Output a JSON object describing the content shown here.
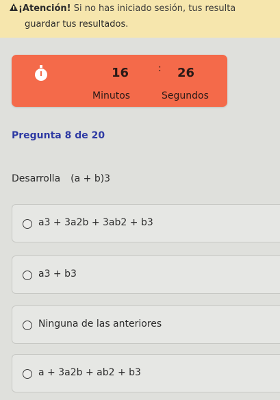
{
  "alert": {
    "title": "¡Atención!",
    "message": "Si no has iniciado sesión, tus resulta",
    "line2": "guardar tus resultados."
  },
  "timer": {
    "minutes": "16",
    "separator": ":",
    "seconds": "26",
    "minutes_label": "Minutos",
    "seconds_label": "Segundos",
    "color": "#f46a4a"
  },
  "question": {
    "counter": "Pregunta 8 de 20",
    "prompt": "Desarrolla",
    "expression": "(a + b)3"
  },
  "options": [
    {
      "label": "a3 + 3a2b + 3ab2 + b3"
    },
    {
      "label": "a3 + b3"
    },
    {
      "label": "Ninguna de las anteriores"
    },
    {
      "label": "a + 3a2b + ab2 + b3"
    }
  ],
  "colors": {
    "alert_bg": "#f6e6ad",
    "counter_text": "#2e3aa3",
    "background": "#dfe0dc"
  }
}
